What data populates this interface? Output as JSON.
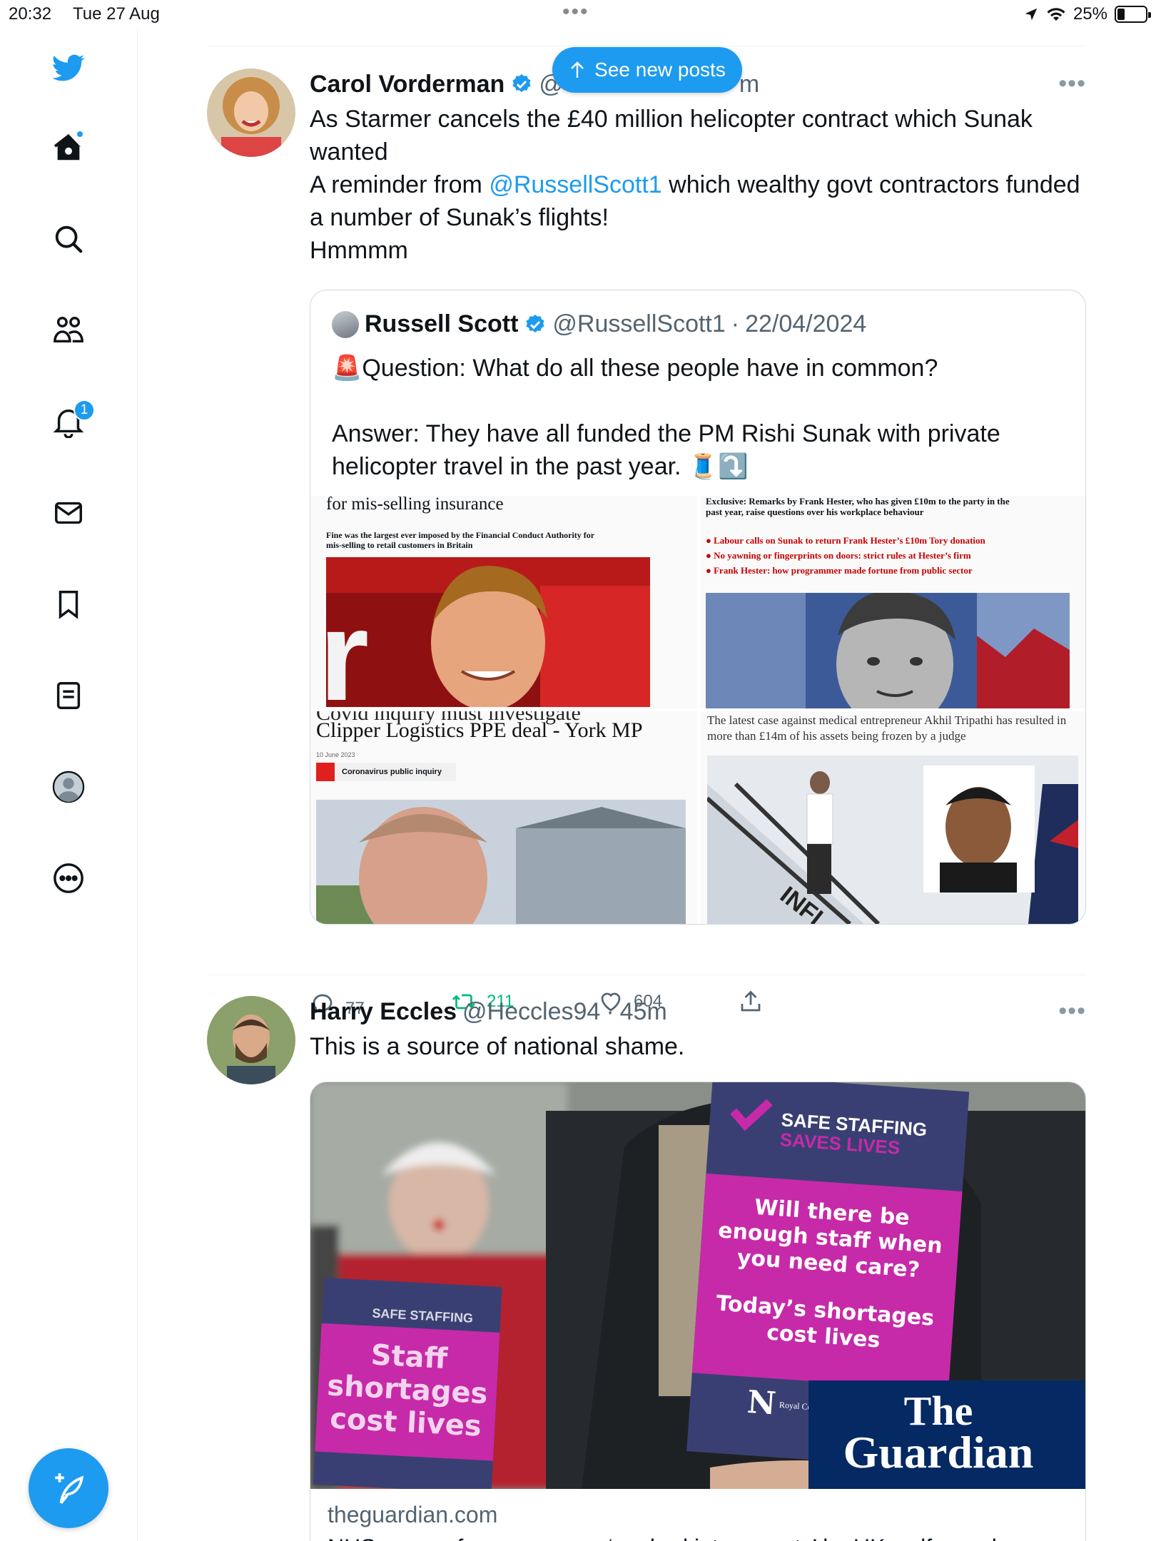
{
  "status_bar": {
    "time": "20:32",
    "date": "Tue 27 Aug",
    "battery": "25%"
  },
  "sidebar": {
    "items": [
      {
        "icon": "twitter-logo-icon"
      },
      {
        "icon": "home-icon"
      },
      {
        "icon": "search-icon"
      },
      {
        "icon": "communities-icon"
      },
      {
        "icon": "notifications-icon",
        "badge": "1"
      },
      {
        "icon": "messages-icon"
      },
      {
        "icon": "bookmarks-icon"
      },
      {
        "icon": "lists-icon"
      },
      {
        "icon": "profile-icon"
      },
      {
        "icon": "more-icon"
      }
    ],
    "compose_icon": "compose-icon"
  },
  "banner": {
    "label": "See new posts"
  },
  "tweets": [
    {
      "name": "Carol Vorderman",
      "handle_visible": "@",
      "handle_tail": "m",
      "text": [
        "As Starmer cancels the £40 million helicopter contract which Sunak wanted",
        "A reminder from ",
        "@RussellScott1",
        " which wealthy govt contractors funded a number of Sunak’s flights!",
        "Hmmmm"
      ],
      "quote": {
        "name": "Russell Scott",
        "handle": "@RussellScott1",
        "date": "22/04/2024",
        "siren": "🚨",
        "line1": "Question: What do all these people have in common?",
        "line2": "Answer: They have all funded the PM Rishi Sunak with private helicopter travel in the past year.",
        "emoji": "🧵⤵️",
        "images": [
          {
            "headline": "for mis-selling insurance",
            "sub": "Fine was the largest ever imposed by the Financial Conduct Authority for mis-selling to retail customers in Britain"
          },
          {
            "intro": "Exclusive: Remarks by Frank Hester, who has given £10m to the party in the past year, raise questions over his workplace behaviour",
            "bullets": [
              "Labour calls on Sunak to return Frank Hester’s £10m Tory donation",
              "No yawning or fingerprints on doors: strict rules at Hester’s firm",
              "Frank Hester: how programmer made fortune from public sector"
            ]
          },
          {
            "headline_top": "Covid inquiry must investigate",
            "headline": "Clipper Logistics PPE deal - York MP",
            "date": "10 June 2023",
            "tag": "Coronavirus public inquiry"
          },
          {
            "caption": "The latest case against medical entrepreneur Akhil Tripathi has resulted in more than £14m of his assets being frozen by a judge",
            "plane_text": "INFI"
          }
        ]
      },
      "actions": {
        "replies": "77",
        "retweets": "211",
        "likes": "604"
      }
    },
    {
      "name": "Harry Eccles",
      "handle": "@Heccles94",
      "time": "45m",
      "text": "This is a source of national shame.",
      "card": {
        "domain": "theguardian.com",
        "title": "NHS nurses from overseas ‘pushed into poverty’ by UK welfare rules",
        "image": {
          "sign_header_1": "SAFE STAFFING",
          "sign_header_2": "SAVES LIVES",
          "sign_q1": "Will there be",
          "sign_q2": "enough staff when",
          "sign_q3": "you need care?",
          "sign_s1": "Today’s shortages",
          "sign_s2": "cost lives",
          "sign_org": "Royal College of Nursing",
          "left_sign_1": "Staff",
          "left_sign_2": "shortages",
          "left_sign_3": "cost lives",
          "left_sign_header": "SAFE STAFFING",
          "brand_1": "The",
          "brand_2": "Guardian"
        }
      }
    }
  ],
  "colors": {
    "accent": "#1d9bf0",
    "retweet": "#00ba7c",
    "text": "#0f1419",
    "muted": "#536471",
    "border": "#cfd9de",
    "guardian": "#052962",
    "sign_pink": "#c62aa8",
    "sign_navy": "#3a3f73"
  }
}
